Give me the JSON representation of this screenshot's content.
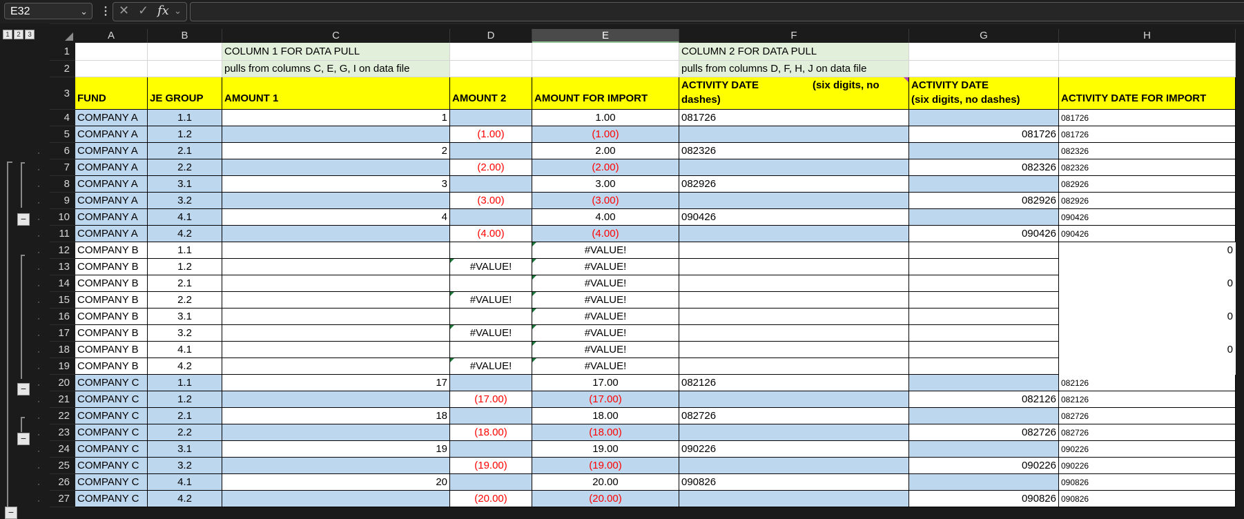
{
  "namebox": {
    "value": "E32"
  },
  "formula_bar": {
    "value": ""
  },
  "outline_levels": [
    "1",
    "2",
    "3"
  ],
  "columns": [
    "A",
    "B",
    "C",
    "D",
    "E",
    "F",
    "G",
    "H"
  ],
  "header_rows": {
    "row1": {
      "num": "1",
      "C": "COLUMN 1 FOR DATA PULL",
      "F": "COLUMN 2 FOR DATA PULL"
    },
    "row2": {
      "num": "2",
      "C": "pulls from columns C, E, G, I on data file",
      "F": "pulls from columns D, F, H, J on data file"
    },
    "row3": {
      "num": "3",
      "A": "FUND",
      "B": "JE GROUP",
      "C": "AMOUNT 1",
      "D": "AMOUNT 2",
      "E": "AMOUNT FOR IMPORT",
      "F_line1": "ACTIVITY DATE",
      "F_line1b": "(six digits, no",
      "F_line2": "dashes)",
      "G_line1": "ACTIVITY DATE",
      "G_line2": "(six digits, no dashes)",
      "H": "ACTIVITY DATE FOR IMPORT"
    }
  },
  "rows": [
    {
      "num": "4",
      "A": "COMPANY A",
      "B": "1.1",
      "C": "1",
      "D": "",
      "E": "1.00",
      "F": "081726",
      "G": "",
      "H": "081726"
    },
    {
      "num": "5",
      "A": "COMPANY A",
      "B": "1.2",
      "C": "",
      "D": "(1.00)",
      "E": "(1.00)",
      "F": "",
      "G": "081726",
      "H": "081726"
    },
    {
      "num": "6",
      "A": "COMPANY A",
      "B": "2.1",
      "C": "2",
      "D": "",
      "E": "2.00",
      "F": "082326",
      "G": "",
      "H": "082326"
    },
    {
      "num": "7",
      "A": "COMPANY A",
      "B": "2.2",
      "C": "",
      "D": "(2.00)",
      "E": "(2.00)",
      "F": "",
      "G": "082326",
      "H": "082326"
    },
    {
      "num": "8",
      "A": "COMPANY A",
      "B": "3.1",
      "C": "3",
      "D": "",
      "E": "3.00",
      "F": "082926",
      "G": "",
      "H": "082926"
    },
    {
      "num": "9",
      "A": "COMPANY A",
      "B": "3.2",
      "C": "",
      "D": "(3.00)",
      "E": "(3.00)",
      "F": "",
      "G": "082926",
      "H": "082926"
    },
    {
      "num": "10",
      "A": "COMPANY A",
      "B": "4.1",
      "C": "4",
      "D": "",
      "E": "4.00",
      "F": "090426",
      "G": "",
      "H": "090426"
    },
    {
      "num": "11",
      "A": "COMPANY A",
      "B": "4.2",
      "C": "",
      "D": "(4.00)",
      "E": "(4.00)",
      "F": "",
      "G": "090426",
      "H": "090426"
    },
    {
      "num": "12",
      "A": "COMPANY B",
      "B": "1.1",
      "C": "",
      "D": "",
      "E": "#VALUE!",
      "F": "",
      "G": "",
      "H": "0"
    },
    {
      "num": "13",
      "A": "COMPANY B",
      "B": "1.2",
      "C": "",
      "D": "#VALUE!",
      "E": "#VALUE!",
      "F": "",
      "G": "",
      "H": ""
    },
    {
      "num": "14",
      "A": "COMPANY B",
      "B": "2.1",
      "C": "",
      "D": "",
      "E": "#VALUE!",
      "F": "",
      "G": "",
      "H": "0"
    },
    {
      "num": "15",
      "A": "COMPANY B",
      "B": "2.2",
      "C": "",
      "D": "#VALUE!",
      "E": "#VALUE!",
      "F": "",
      "G": "",
      "H": ""
    },
    {
      "num": "16",
      "A": "COMPANY B",
      "B": "3.1",
      "C": "",
      "D": "",
      "E": "#VALUE!",
      "F": "",
      "G": "",
      "H": "0"
    },
    {
      "num": "17",
      "A": "COMPANY B",
      "B": "3.2",
      "C": "",
      "D": "#VALUE!",
      "E": "#VALUE!",
      "F": "",
      "G": "",
      "H": ""
    },
    {
      "num": "18",
      "A": "COMPANY B",
      "B": "4.1",
      "C": "",
      "D": "",
      "E": "#VALUE!",
      "F": "",
      "G": "",
      "H": "0"
    },
    {
      "num": "19",
      "A": "COMPANY B",
      "B": "4.2",
      "C": "",
      "D": "#VALUE!",
      "E": "#VALUE!",
      "F": "",
      "G": "",
      "H": ""
    },
    {
      "num": "20",
      "A": "COMPANY C",
      "B": "1.1",
      "C": "17",
      "D": "",
      "E": "17.00",
      "F": "082126",
      "G": "",
      "H": "082126"
    },
    {
      "num": "21",
      "A": "COMPANY C",
      "B": "1.2",
      "C": "",
      "D": "(17.00)",
      "E": "(17.00)",
      "F": "",
      "G": "082126",
      "H": "082126"
    },
    {
      "num": "22",
      "A": "COMPANY C",
      "B": "2.1",
      "C": "18",
      "D": "",
      "E": "18.00",
      "F": "082726",
      "G": "",
      "H": "082726"
    },
    {
      "num": "23",
      "A": "COMPANY C",
      "B": "2.2",
      "C": "",
      "D": "(18.00)",
      "E": "(18.00)",
      "F": "",
      "G": "082726",
      "H": "082726"
    },
    {
      "num": "24",
      "A": "COMPANY C",
      "B": "3.1",
      "C": "19",
      "D": "",
      "E": "19.00",
      "F": "090226",
      "G": "",
      "H": "090226"
    },
    {
      "num": "25",
      "A": "COMPANY C",
      "B": "3.2",
      "C": "",
      "D": "(19.00)",
      "E": "(19.00)",
      "F": "",
      "G": "090226",
      "H": "090226"
    },
    {
      "num": "26",
      "A": "COMPANY C",
      "B": "4.1",
      "C": "20",
      "D": "",
      "E": "20.00",
      "F": "090826",
      "G": "",
      "H": "090826"
    },
    {
      "num": "27",
      "A": "COMPANY C",
      "B": "4.2",
      "C": "",
      "D": "(20.00)",
      "E": "(20.00)",
      "F": "",
      "G": "090826",
      "H": "090826"
    }
  ],
  "colors": {
    "blue_fill": "#bdd7ee",
    "yellow_fill": "#ffff00",
    "green_fill": "#e2efda",
    "negative_red": "#ff0000",
    "error_marker": "#1f7a3a"
  }
}
